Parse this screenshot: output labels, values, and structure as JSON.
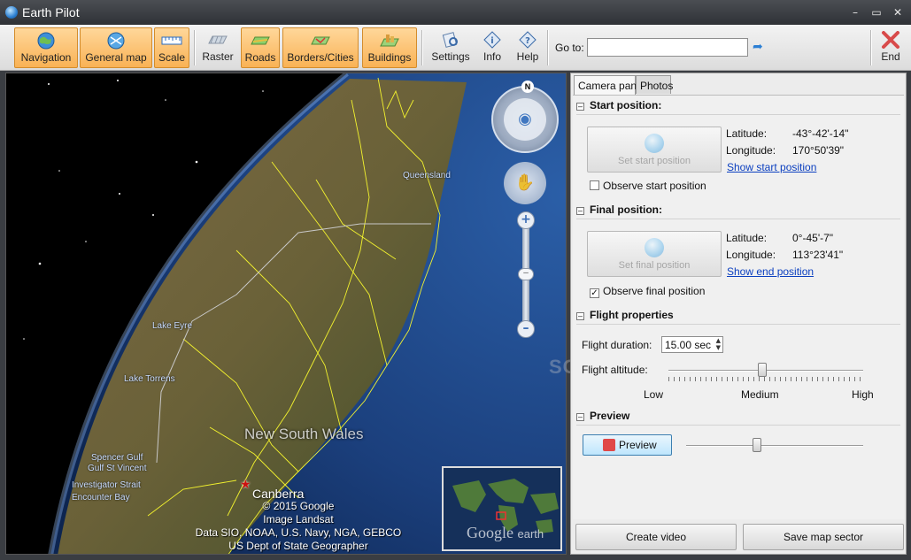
{
  "window": {
    "title": "Earth Pilot",
    "minimize": "–",
    "maximize": "▭",
    "close": "✕"
  },
  "toolbar": {
    "buttons": [
      {
        "label": "Navigation",
        "icon": "globe-icon",
        "active": true
      },
      {
        "label": "General map",
        "icon": "map-globe-icon",
        "active": true
      },
      {
        "label": "Scale",
        "icon": "ruler-icon",
        "active": true
      },
      {
        "label": "Raster",
        "icon": "raster-icon",
        "active": false
      },
      {
        "label": "Roads",
        "icon": "roads-icon",
        "active": true
      },
      {
        "label": "Borders/Cities",
        "icon": "borders-icon",
        "active": true
      },
      {
        "label": "Buildings",
        "icon": "buildings-icon",
        "active": true
      },
      {
        "label": "Settings",
        "icon": "settings-icon",
        "active": false
      },
      {
        "label": "Info",
        "icon": "info-icon",
        "active": false
      },
      {
        "label": "Help",
        "icon": "help-icon",
        "active": false
      },
      {
        "label": "End",
        "icon": "close-x-icon",
        "active": false
      }
    ],
    "goto_label": "Go to:",
    "goto_value": ""
  },
  "map": {
    "labels": {
      "region": "New South Wales",
      "city": "Canberra",
      "lake_eyre": "Lake Eyre",
      "lake_torrens": "Lake Torrens",
      "spencer_gulf": "Spencer Gulf",
      "gulf_st_vincent": "Gulf St Vincent",
      "investigator_strait": "Investigator Strait",
      "encounter_bay": "Encounter Bay",
      "queensland": "Queensland"
    },
    "attribution": [
      "© 2015 Google",
      "Image Landsat",
      "Data SIO, NOAA, U.S. Navy, NGA, GEBCO",
      "US Dept of State Geographer"
    ],
    "compass_letter": "N",
    "brand": "Google",
    "brand_suffix": "earth",
    "watermark": "SOFTPEDIA"
  },
  "panel": {
    "tabs": [
      "Camera pan",
      "Photos"
    ],
    "start": {
      "heading": "Start position:",
      "button": "Set start position",
      "lat_label": "Latitude:",
      "lat": "-43°-42'-14\"",
      "lon_label": "Longitude:",
      "lon": "170°50'39\"",
      "link": "Show start position",
      "observe": "Observe start position",
      "observe_checked": false
    },
    "final": {
      "heading": "Final position:",
      "button": "Set final position",
      "lat_label": "Latitude:",
      "lat": "0°-45'-7\"",
      "lon_label": "Longitude:",
      "lon": "113°23'41\"",
      "link": "Show end position",
      "observe": "Observe final position",
      "observe_checked": true
    },
    "flight": {
      "heading": "Flight properties",
      "duration_label": "Flight duration:",
      "duration": "15.00 sec",
      "altitude_label": "Flight altitude:",
      "low": "Low",
      "medium": "Medium",
      "high": "High",
      "altitude_level": 0.48
    },
    "preview": {
      "heading": "Preview",
      "button": "Preview",
      "slider_level": 0.4
    },
    "footer": {
      "create_video": "Create video",
      "save_sector": "Save map sector"
    }
  }
}
